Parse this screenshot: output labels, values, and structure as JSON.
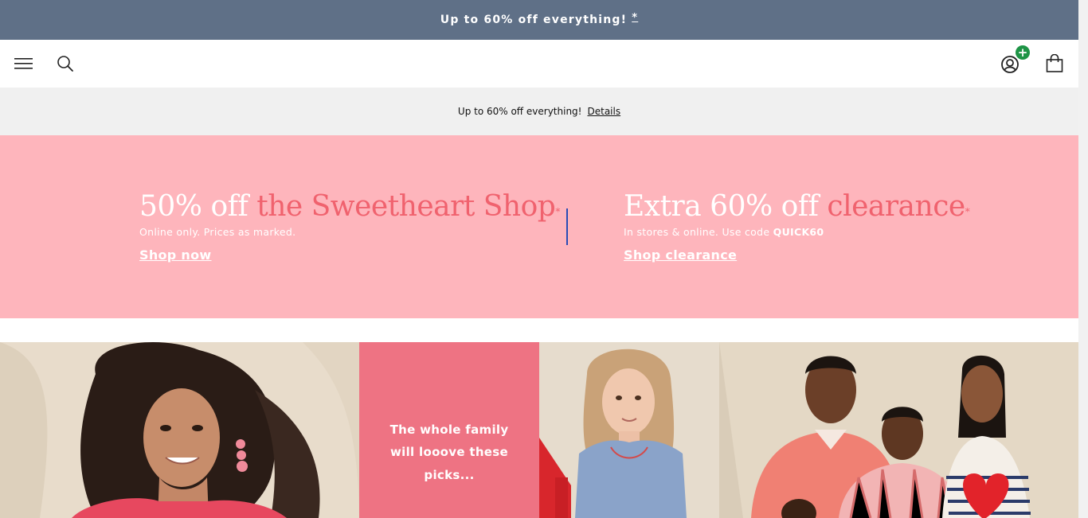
{
  "promo_bar": {
    "text": "Up to 60% off everything!",
    "asterisk": "*"
  },
  "header": {
    "menu_icon": "hamburger-menu-icon",
    "search_icon": "search-icon",
    "account_icon": "account-icon",
    "account_badge": "+",
    "bag_icon": "shopping-bag-icon"
  },
  "subpromo": {
    "text": "Up to 60% off everything!",
    "link": "Details"
  },
  "hero": {
    "left": {
      "title_start": "50% off",
      "title_accent": "the Sweetheart Shop",
      "asterisk": "*",
      "sub": "Online only. Prices as marked.",
      "cta": "Shop now"
    },
    "right": {
      "title_start": "Extra 60% off",
      "title_accent": "clearance",
      "asterisk": "*",
      "sub_prefix": "In stores & online. Use code",
      "code": "QUICK60",
      "cta": "Shop clearance"
    }
  },
  "gallery": {
    "text_tile": "The whole family will looove these picks..."
  },
  "colors": {
    "promo_bar_bg": "#5f7087",
    "hero_bg": "#feb5bc",
    "accent": "#f0626e",
    "text_tile_bg": "#ee7383",
    "badge_green": "#1e9446",
    "divider": "#2a4bb5"
  }
}
